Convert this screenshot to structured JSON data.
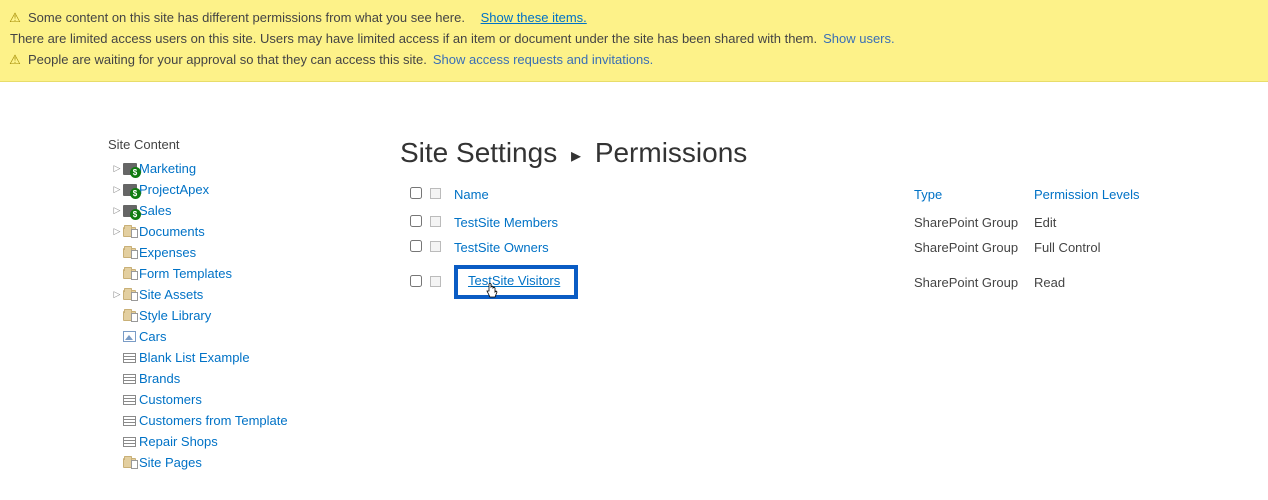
{
  "notifications": {
    "line1_text": "Some content on this site has different permissions from what you see here.",
    "line1_link": "Show these items.",
    "line2_text": "There are limited access users on this site. Users may have limited access if an item or document under the site has been shared with them.",
    "line2_link": "Show users.",
    "line3_text": "People are waiting for your approval so that they can access this site.",
    "line3_link": "Show access requests and invitations."
  },
  "sidebar": {
    "title": "Site Content",
    "items": [
      {
        "label": "Marketing",
        "icon": "site",
        "expandable": true
      },
      {
        "label": "ProjectApex",
        "icon": "site",
        "expandable": true
      },
      {
        "label": "Sales",
        "icon": "site",
        "expandable": true
      },
      {
        "label": "Documents",
        "icon": "folder-doc",
        "expandable": true
      },
      {
        "label": "Expenses",
        "icon": "folder-doc",
        "expandable": false
      },
      {
        "label": "Form Templates",
        "icon": "folder-doc",
        "expandable": false
      },
      {
        "label": "Site Assets",
        "icon": "folder-doc",
        "expandable": true
      },
      {
        "label": "Style Library",
        "icon": "folder-doc",
        "expandable": false
      },
      {
        "label": "Cars",
        "icon": "image",
        "expandable": false
      },
      {
        "label": "Blank List Example",
        "icon": "list",
        "expandable": false
      },
      {
        "label": "Brands",
        "icon": "list",
        "expandable": false
      },
      {
        "label": "Customers",
        "icon": "list",
        "expandable": false
      },
      {
        "label": "Customers from Template",
        "icon": "list",
        "expandable": false
      },
      {
        "label": "Repair Shops",
        "icon": "list",
        "expandable": false
      },
      {
        "label": "Site Pages",
        "icon": "folder-doc",
        "expandable": false
      }
    ]
  },
  "breadcrumb": {
    "part1": "Site Settings",
    "part2": "Permissions"
  },
  "table": {
    "headers": {
      "name": "Name",
      "type": "Type",
      "level": "Permission Levels"
    },
    "rows": [
      {
        "name": "TestSite Members",
        "type": "SharePoint Group",
        "level": "Edit",
        "highlighted": false
      },
      {
        "name": "TestSite Owners",
        "type": "SharePoint Group",
        "level": "Full Control",
        "highlighted": false
      },
      {
        "name": "TestSite Visitors",
        "type": "SharePoint Group",
        "level": "Read",
        "highlighted": true
      }
    ]
  }
}
